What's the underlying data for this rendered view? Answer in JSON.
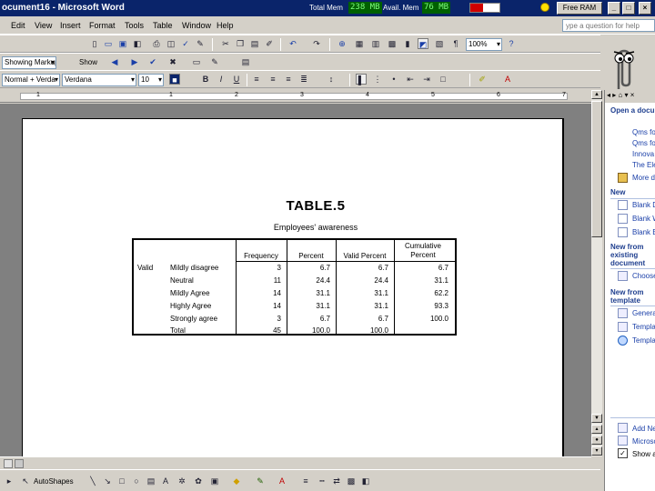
{
  "titlebar": {
    "title": "ocument16 - Microsoft Word",
    "total_mem_label": "Total Mem",
    "total_mem_value": "238 MB",
    "avail_mem_label": "Avail. Mem",
    "avail_mem_value": "76 MB",
    "free_ram_label": "Free RAM"
  },
  "menu": {
    "items": [
      "Edit",
      "View",
      "Insert",
      "Format",
      "Tools",
      "Table",
      "Window",
      "Help"
    ],
    "help_placeholder": "ype a question for help"
  },
  "toolbar1": {
    "zoom": "100%"
  },
  "toolbar2": {
    "markup": "Showing Markup",
    "show": "Show"
  },
  "toolbar3": {
    "style": "Normal + Verda",
    "font": "Verdana",
    "size": "10"
  },
  "ruler": {
    "ticks": [
      "1",
      "1",
      "2",
      "3",
      "4",
      "5",
      "6",
      "7"
    ]
  },
  "document": {
    "title": "TABLE.5",
    "subtitle": "Employees' awareness",
    "table": {
      "headers": [
        "Frequency",
        "Percent",
        "Valid Percent",
        "Cumulative Percent"
      ],
      "valid_label": "Valid",
      "rows": [
        {
          "label": "Mildly disagree",
          "values": [
            "3",
            "6.7",
            "6.7",
            "6.7"
          ]
        },
        {
          "label": "Neutral",
          "values": [
            "11",
            "24.4",
            "24.4",
            "31.1"
          ]
        },
        {
          "label": "Mildly Agree",
          "values": [
            "14",
            "31.1",
            "31.1",
            "62.2"
          ]
        },
        {
          "label": "Highly Agree",
          "values": [
            "14",
            "31.1",
            "31.1",
            "93.3"
          ]
        },
        {
          "label": "Strongly agree",
          "values": [
            "3",
            "6.7",
            "6.7",
            "100.0"
          ]
        },
        {
          "label": "Total",
          "values": [
            "45",
            "100.0",
            "100.0",
            ""
          ]
        }
      ]
    }
  },
  "taskpane": {
    "open_header": "Open a document",
    "open_links": [
      "Qms fo",
      "Qms fo",
      "Innova",
      "The Ele",
      "More do"
    ],
    "new_header": "New",
    "new_links": [
      "Blank D",
      "Blank W",
      "Blank E"
    ],
    "new_existing_header": "New from existing document",
    "choose_link": "Choose",
    "template_header": "New from template",
    "template_links": [
      "Genera",
      "Templa",
      "Templa"
    ],
    "bottom_links": [
      "Add Ne",
      "Microso",
      "Show a"
    ]
  },
  "drawing": {
    "autoshapes": "AutoShapes"
  }
}
